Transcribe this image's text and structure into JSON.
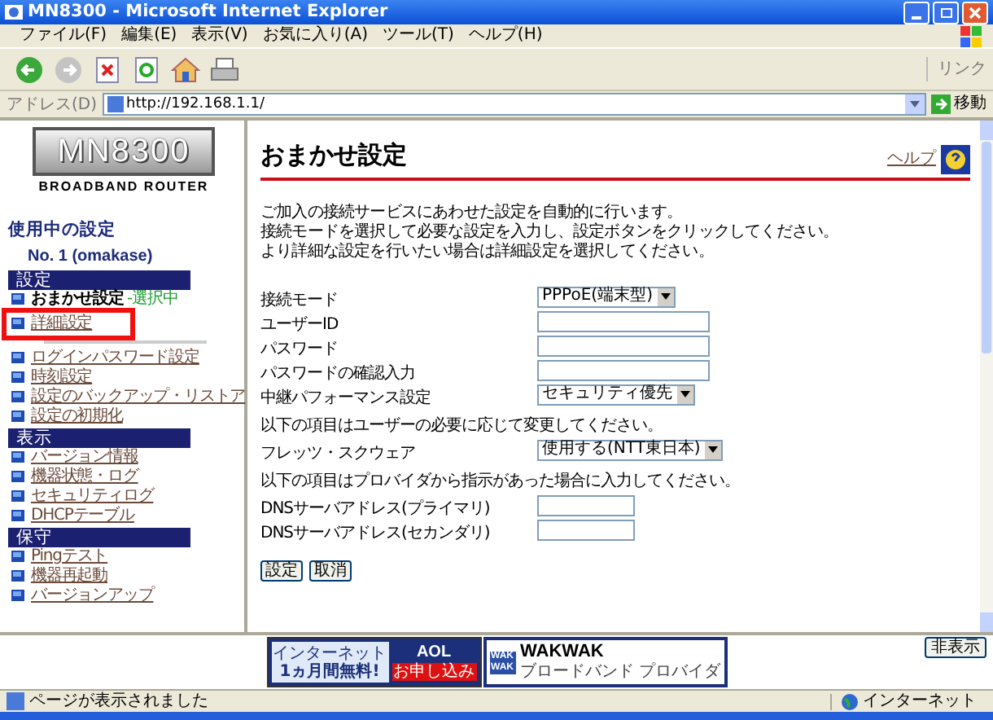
{
  "window": {
    "title": "MN8300 - Microsoft Internet Explorer"
  },
  "menu": [
    "ファイル(F)",
    "編集(E)",
    "表示(V)",
    "お気に入り(A)",
    "ツール(T)",
    "ヘルプ(H)"
  ],
  "links_label": "リンク",
  "address": {
    "label": "アドレス(D)",
    "value": "http://192.168.1.1/",
    "go": "移動"
  },
  "sidebar": {
    "logo": "MN8300",
    "logo_sub": "BROADBAND ROUTER",
    "current_heading": "使用中の設定",
    "current_value": "No. 1 (omakase)",
    "sections": [
      {
        "title": "設定",
        "items": [
          {
            "label": "おまかせ設定",
            "kind": "current",
            "status": "-選択中",
            "boxed": false,
            "divider_after": false
          },
          {
            "label": "詳細設定",
            "kind": "link",
            "boxed": true,
            "divider_after": true
          },
          {
            "label": "ログインパスワード設定",
            "kind": "link",
            "boxed": false,
            "divider_after": false
          },
          {
            "label": "時刻設定",
            "kind": "link",
            "boxed": false,
            "divider_after": false
          },
          {
            "label": "設定のバックアップ・リストア",
            "kind": "link",
            "boxed": false,
            "divider_after": false
          },
          {
            "label": "設定の初期化",
            "kind": "link",
            "boxed": false,
            "divider_after": false
          }
        ]
      },
      {
        "title": "表示",
        "items": [
          {
            "label": "バージョン情報",
            "kind": "link",
            "boxed": false,
            "divider_after": false
          },
          {
            "label": "機器状態・ログ",
            "kind": "link",
            "boxed": false,
            "divider_after": false
          },
          {
            "label": "セキュリティログ",
            "kind": "link",
            "boxed": false,
            "divider_after": false
          },
          {
            "label": "DHCPテーブル",
            "kind": "link",
            "boxed": false,
            "divider_after": false
          }
        ]
      },
      {
        "title": "保守",
        "items": [
          {
            "label": "Pingテスト",
            "kind": "link",
            "boxed": false,
            "divider_after": false
          },
          {
            "label": "機器再起動",
            "kind": "link",
            "boxed": false,
            "divider_after": false
          },
          {
            "label": "バージョンアップ",
            "kind": "link",
            "boxed": false,
            "divider_after": false
          }
        ]
      }
    ]
  },
  "main": {
    "title": "おまかせ設定",
    "help": "ヘルプ",
    "intro": [
      "ご加入の接続サービスにあわせた設定を自動的に行います。",
      "接続モードを選択して必要な設定を入力し、設定ボタンをクリックしてください。",
      "より詳細な設定を行いたい場合は詳細設定を選択してください。"
    ],
    "form": [
      {
        "kind": "select",
        "label": "接続モード",
        "value": "PPPoE(端末型)"
      },
      {
        "kind": "text",
        "label": "ユーザーID"
      },
      {
        "kind": "text",
        "label": "パスワード"
      },
      {
        "kind": "text",
        "label": "パスワードの確認入力"
      },
      {
        "kind": "select",
        "label": "中継パフォーマンス設定",
        "value": "セキュリティ優先"
      },
      {
        "kind": "note",
        "label": "以下の項目はユーザーの必要に応じて変更してください。"
      },
      {
        "kind": "select",
        "label": "フレッツ・スクウェア",
        "value": "使用する(NTT東日本)"
      },
      {
        "kind": "note",
        "label": "以下の項目はプロバイダから指示があった場合に入力してください。"
      },
      {
        "kind": "short",
        "label": "DNSサーバアドレス(プライマリ)"
      },
      {
        "kind": "short",
        "label": "DNSサーバアドレス(セカンダリ)"
      }
    ],
    "buttons": [
      "設定",
      "取消"
    ]
  },
  "banners": [
    {
      "kind": "aol",
      "line1": "インターネット",
      "line2": "1ヵ月間無料!",
      "brand": "AOL",
      "cta": "お申し込み"
    },
    {
      "kind": "wakwak",
      "mark1": "WAK",
      "mark2": "WAK",
      "brand": "WAKWAK",
      "line1": "ブロードバンド",
      "line2": "プロバイダ"
    }
  ],
  "hide_button": "非表示",
  "status_bar": {
    "text": "ページが表示されました",
    "zone": "インターネット"
  }
}
